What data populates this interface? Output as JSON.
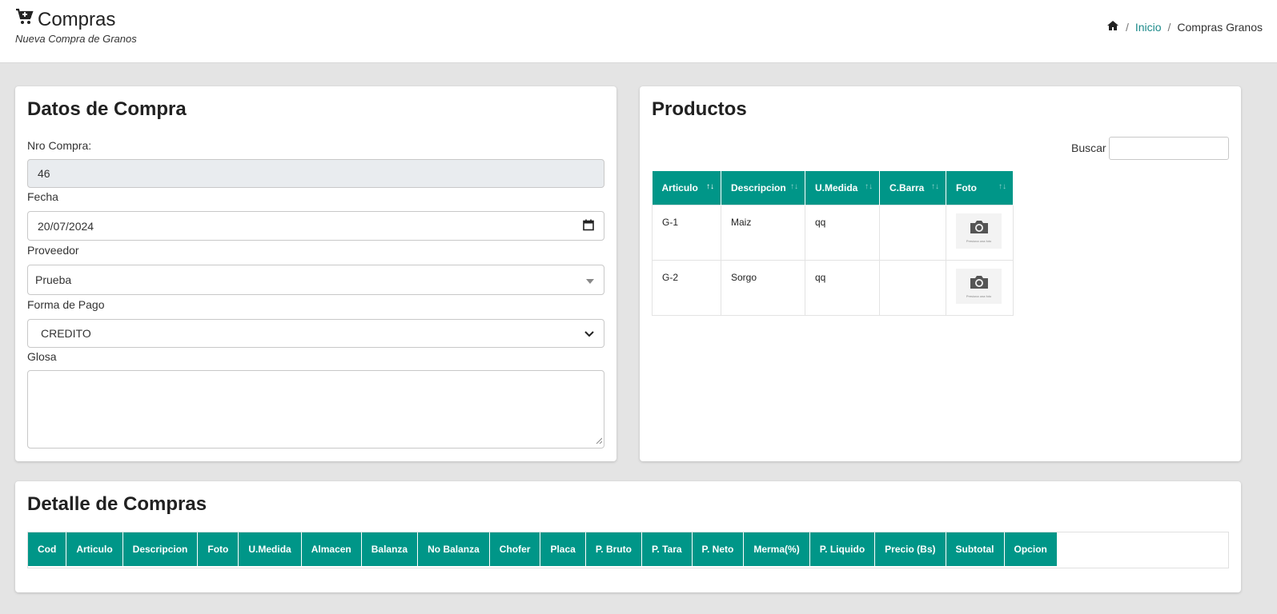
{
  "header": {
    "title": "Compras",
    "subtitle": "Nueva Compra de Granos",
    "breadcrumb": {
      "home_icon": "home-icon",
      "link": "Inicio",
      "current": "Compras Granos"
    },
    "title_icon": "cart-plus-icon"
  },
  "datos": {
    "title": "Datos de Compra",
    "nro_label": "Nro Compra:",
    "nro_value": "46",
    "fecha_label": "Fecha",
    "fecha_value": "20/07/2024",
    "proveedor_label": "Proveedor",
    "proveedor_value": "Prueba",
    "pago_label": "Forma de Pago",
    "pago_value": "CREDITO",
    "glosa_label": "Glosa",
    "glosa_value": ""
  },
  "productos": {
    "title": "Productos",
    "search_label": "Buscar",
    "columns": [
      "Articulo",
      "Descripcion",
      "U.Medida",
      "C.Barra",
      "Foto"
    ],
    "rows": [
      {
        "articulo": "G-1",
        "descripcion": "Maiz",
        "umedida": "qq",
        "cbarra": "",
        "foto_caption": "Presiona una foto"
      },
      {
        "articulo": "G-2",
        "descripcion": "Sorgo",
        "umedida": "qq",
        "cbarra": "",
        "foto_caption": "Presiona una foto"
      }
    ]
  },
  "detalle": {
    "title": "Detalle de Compras",
    "columns": [
      "Cod",
      "Articulo",
      "Descripcion",
      "Foto",
      "U.Medida",
      "Almacen",
      "Balanza",
      "No Balanza",
      "Chofer",
      "Placa",
      "P. Bruto",
      "P. Tara",
      "P. Neto",
      "Merma(%)",
      "P. Liquido",
      "Precio (Bs)",
      "Subtotal",
      "Opcion"
    ]
  },
  "colors": {
    "accent": "#009688",
    "link": "#1b8a8a",
    "background": "#e4e4e4"
  }
}
